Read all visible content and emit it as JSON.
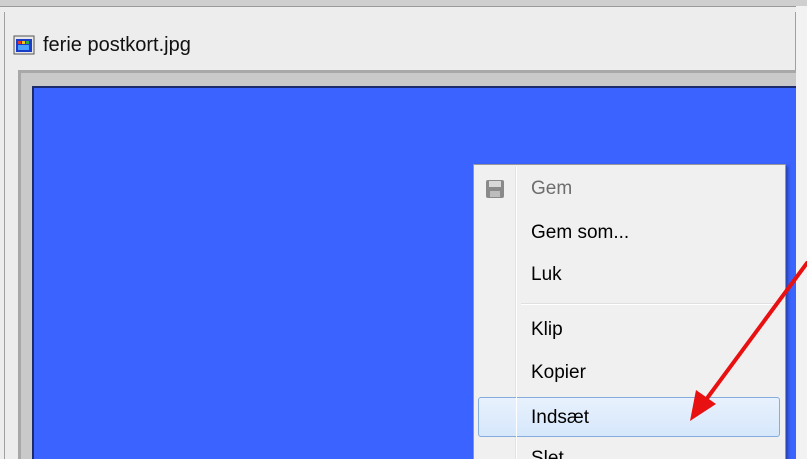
{
  "window": {
    "title": "ferie postkort.jpg",
    "title_icon": "image-file-icon"
  },
  "canvas": {
    "background_color": "#3a63ff"
  },
  "context_menu": {
    "items": [
      {
        "label": "Gem",
        "enabled": false,
        "icon": "floppy-disk-icon"
      },
      {
        "label": "Gem som...",
        "enabled": true
      },
      {
        "label": "Luk",
        "enabled": true
      },
      {
        "label": "Klip",
        "enabled": true
      },
      {
        "label": "Kopier",
        "enabled": true
      },
      {
        "label": "Indsæt",
        "enabled": true,
        "highlighted": true
      },
      {
        "label": "Slet",
        "enabled": true
      }
    ]
  },
  "annotation": {
    "arrow_color": "#e81010",
    "points_to": "Indsæt"
  }
}
